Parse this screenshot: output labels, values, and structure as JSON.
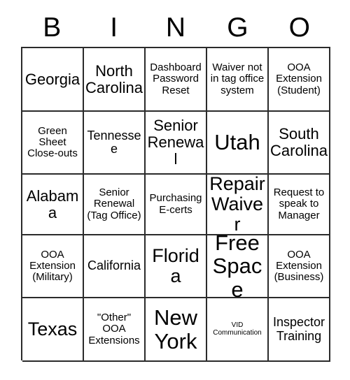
{
  "card": {
    "title": "BINGO",
    "header_letters": [
      "B",
      "I",
      "N",
      "G",
      "O"
    ],
    "border_color": "#2b2b2b",
    "background_color": "#ffffff",
    "text_color": "#000000",
    "rows": 5,
    "columns": 5,
    "cells": [
      {
        "text": "Georgia",
        "size": "lg",
        "free": false
      },
      {
        "text": "North Carolina",
        "size": "lg",
        "free": false
      },
      {
        "text": "Dashboard Password Reset",
        "size": "sm",
        "free": false
      },
      {
        "text": "Waiver not in tag office system",
        "size": "sm",
        "free": false
      },
      {
        "text": "OOA Extension (Student)",
        "size": "sm",
        "free": false
      },
      {
        "text": "Green Sheet Close-outs",
        "size": "sm",
        "free": false
      },
      {
        "text": "Tennessee",
        "size": "md",
        "free": false
      },
      {
        "text": "Senior Renewal",
        "size": "lg",
        "free": false
      },
      {
        "text": "Utah",
        "size": "xxl",
        "free": false
      },
      {
        "text": "South Carolina",
        "size": "lg",
        "free": false
      },
      {
        "text": "Alabama",
        "size": "lg",
        "free": false
      },
      {
        "text": "Senior Renewal (Tag Office)",
        "size": "sm",
        "free": false
      },
      {
        "text": "Purchasing E-certs",
        "size": "sm",
        "free": false
      },
      {
        "text": "Repair Waiver",
        "size": "xl",
        "free": false
      },
      {
        "text": "Request to speak to Manager",
        "size": "sm",
        "free": false
      },
      {
        "text": "OOA Extension (Military)",
        "size": "sm",
        "free": false
      },
      {
        "text": "California",
        "size": "md",
        "free": false
      },
      {
        "text": "Florida",
        "size": "xl",
        "free": false
      },
      {
        "text": "Free Space",
        "size": "xxl",
        "free": true
      },
      {
        "text": "OOA Extension (Business)",
        "size": "sm",
        "free": false
      },
      {
        "text": "Texas",
        "size": "xl",
        "free": false
      },
      {
        "text": "\"Other\" OOA Extensions",
        "size": "sm",
        "free": false
      },
      {
        "text": "New York",
        "size": "xxl",
        "free": false
      },
      {
        "text": "VID Communication",
        "size": "xxs",
        "free": false
      },
      {
        "text": "Inspector Training",
        "size": "md",
        "free": false
      }
    ]
  }
}
